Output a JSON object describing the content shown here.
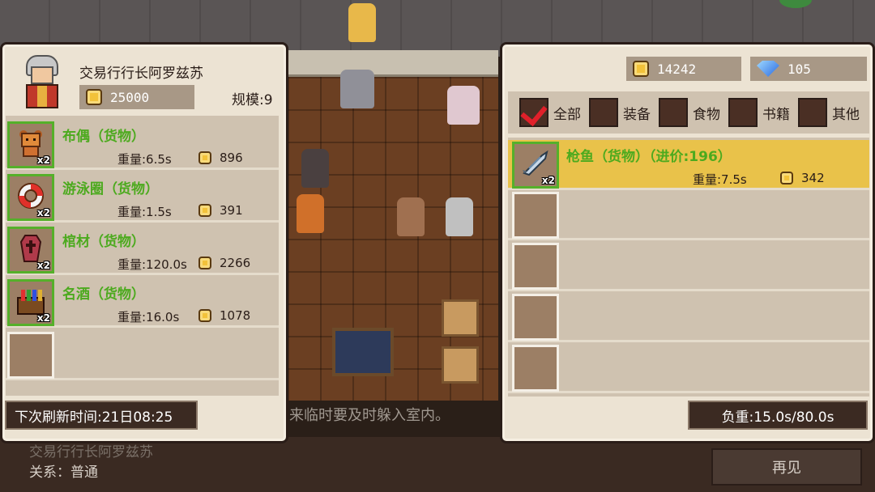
{
  "scene": {
    "banner_text": "来临时要及时躲入室内。",
    "npc_name": "交易行行长阿罗兹苏",
    "relation": "关系：普通",
    "bye_label": "再见"
  },
  "merchant": {
    "name": "交易行行长阿罗兹苏",
    "gold": "25000",
    "scale": "规模:9",
    "refresh": "下次刷新时间:21日08:25",
    "items": [
      {
        "name": "布偶（货物）",
        "qty": "x2",
        "weight": "重量:6.5s",
        "price": "896",
        "icon": "doll-icon"
      },
      {
        "name": "游泳圈（货物）",
        "qty": "x2",
        "weight": "重量:1.5s",
        "price": "391",
        "icon": "swim-ring-icon"
      },
      {
        "name": "棺材（货物）",
        "qty": "x2",
        "weight": "重量:120.0s",
        "price": "2266",
        "icon": "coffin-icon"
      },
      {
        "name": "名酒（货物）",
        "qty": "x2",
        "weight": "重量:16.0s",
        "price": "1078",
        "icon": "wine-crate-icon"
      }
    ]
  },
  "player": {
    "gold": "14242",
    "gems": "105",
    "filters": [
      {
        "label": "全部",
        "checked": true
      },
      {
        "label": "装备",
        "checked": false
      },
      {
        "label": "食物",
        "checked": false
      },
      {
        "label": "书籍",
        "checked": false
      },
      {
        "label": "其他",
        "checked": false
      }
    ],
    "items": [
      {
        "name": "枪鱼（货物）（进价:196）",
        "qty": "x2",
        "weight": "重量:7.5s",
        "price": "342",
        "icon": "fish-icon"
      }
    ],
    "load": "负重:15.0s/80.0s"
  },
  "colors": {
    "item_name": "#4caa1e",
    "selected_row": "#e9c24a",
    "panel_bg": "#ece3d3"
  }
}
